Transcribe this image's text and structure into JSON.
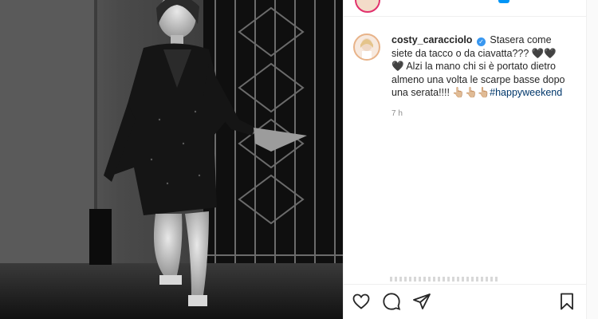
{
  "post": {
    "username": "costy_caracciolo",
    "caption": "Stasera come siete da tacco o da ciavatta??? 🖤🖤🖤 Alzi la mano chi si è portato dietro almeno una volta le scarpe basse dopo una serata!!!! 👆🏼👆🏼👆🏼",
    "hashtag": "#happyweekend",
    "timestamp": "7 h"
  },
  "icons": {
    "like": "heart-icon",
    "comment": "comment-icon",
    "share": "paper-plane-icon",
    "save": "bookmark-icon",
    "verified": "verified-badge-icon"
  },
  "colors": {
    "verified": "#3897f0",
    "hashtag": "#00376b",
    "muted": "#8e8e8e"
  }
}
